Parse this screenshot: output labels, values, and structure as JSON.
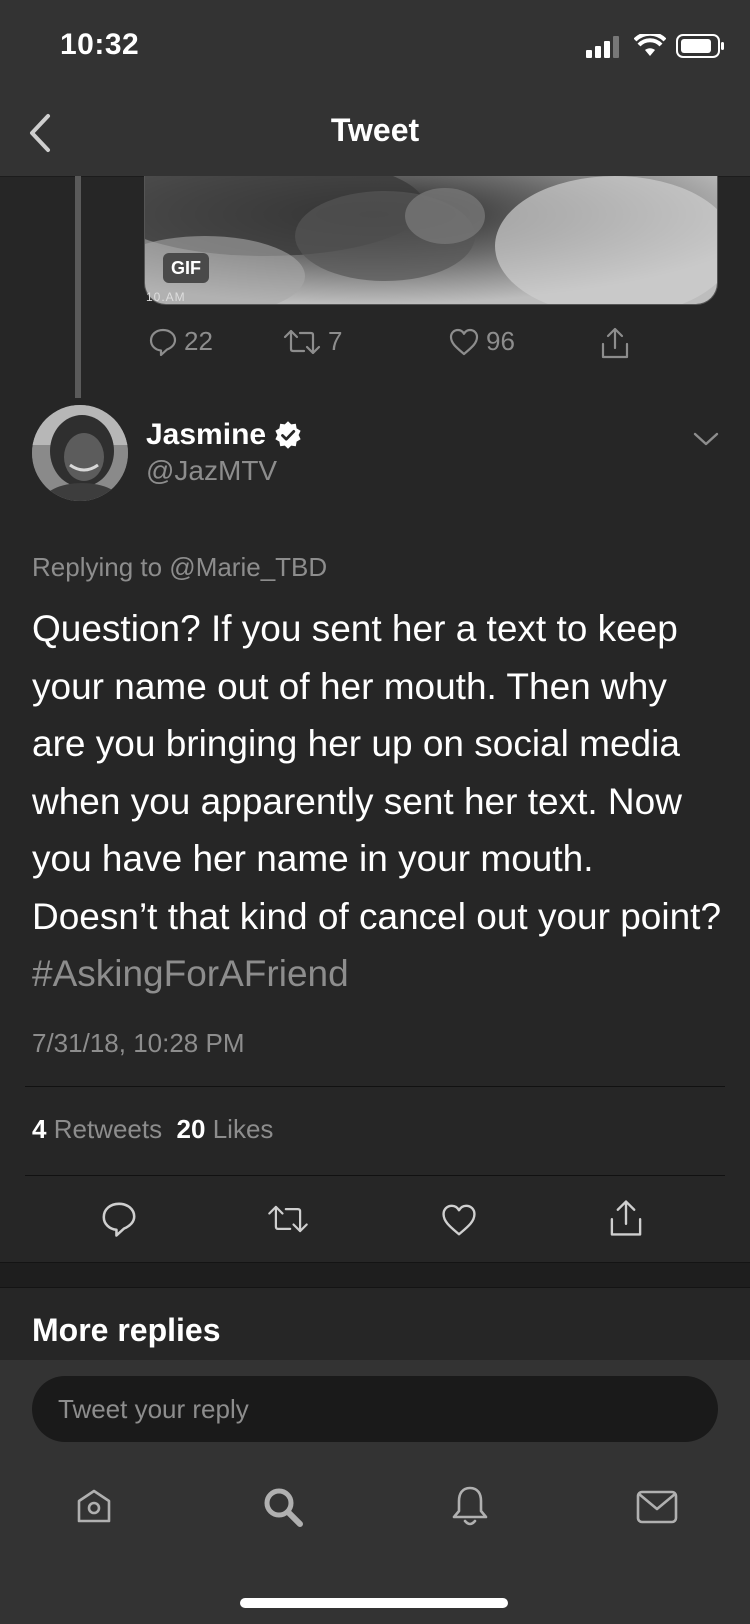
{
  "status_bar": {
    "time": "10:32",
    "icons": [
      "cellular-signal-icon",
      "wifi-icon",
      "battery-icon"
    ]
  },
  "nav": {
    "title": "Tweet",
    "back_icon": "chevron-left-icon"
  },
  "previous_tweet": {
    "media_badge": "GIF",
    "media_stamp": "10.AM",
    "actions": {
      "replies": "22",
      "retweets": "7",
      "likes": "96"
    }
  },
  "tweet": {
    "author": {
      "name": "Jasmine",
      "handle": "@JazMTV",
      "verified": true
    },
    "replying_to": "Replying to @Marie_TBD",
    "text": "Question? If you sent her a text to keep your name out of her mouth. Then why are you bringing her up on social media when you apparently sent her text.  Now you have her name in your mouth. Doesn’t that kind of cancel out your point? ",
    "hashtag": "#AskingForAFriend",
    "timestamp": "7/31/18, 10:28 PM",
    "stats": {
      "retweets_count": "4",
      "retweets_label": "Retweets",
      "likes_count": "20",
      "likes_label": "Likes"
    }
  },
  "more_replies": "More replies",
  "composer": {
    "placeholder": "Tweet your reply"
  },
  "tab_bar": [
    "home-icon",
    "search-icon",
    "notifications-icon",
    "messages-icon"
  ],
  "colors": {
    "background": "#262626",
    "bar": "#333333",
    "muted_text": "#8d8d8d",
    "text": "#ffffff"
  }
}
